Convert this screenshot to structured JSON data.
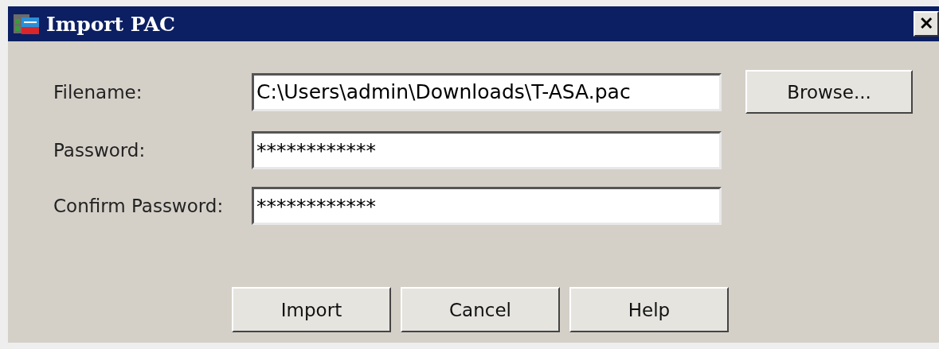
{
  "window": {
    "title": "Import PAC",
    "close": "✕"
  },
  "fields": [
    {
      "label": "Filename:",
      "value": "C:\\Users\\admin\\Downloads\\T-ASA.pac"
    },
    {
      "label": "Password:",
      "value": "************"
    },
    {
      "label": "Confirm Password:",
      "value": "************"
    }
  ],
  "browse_button": "Browse...",
  "buttons": [
    "Import",
    "Cancel",
    "Help"
  ]
}
